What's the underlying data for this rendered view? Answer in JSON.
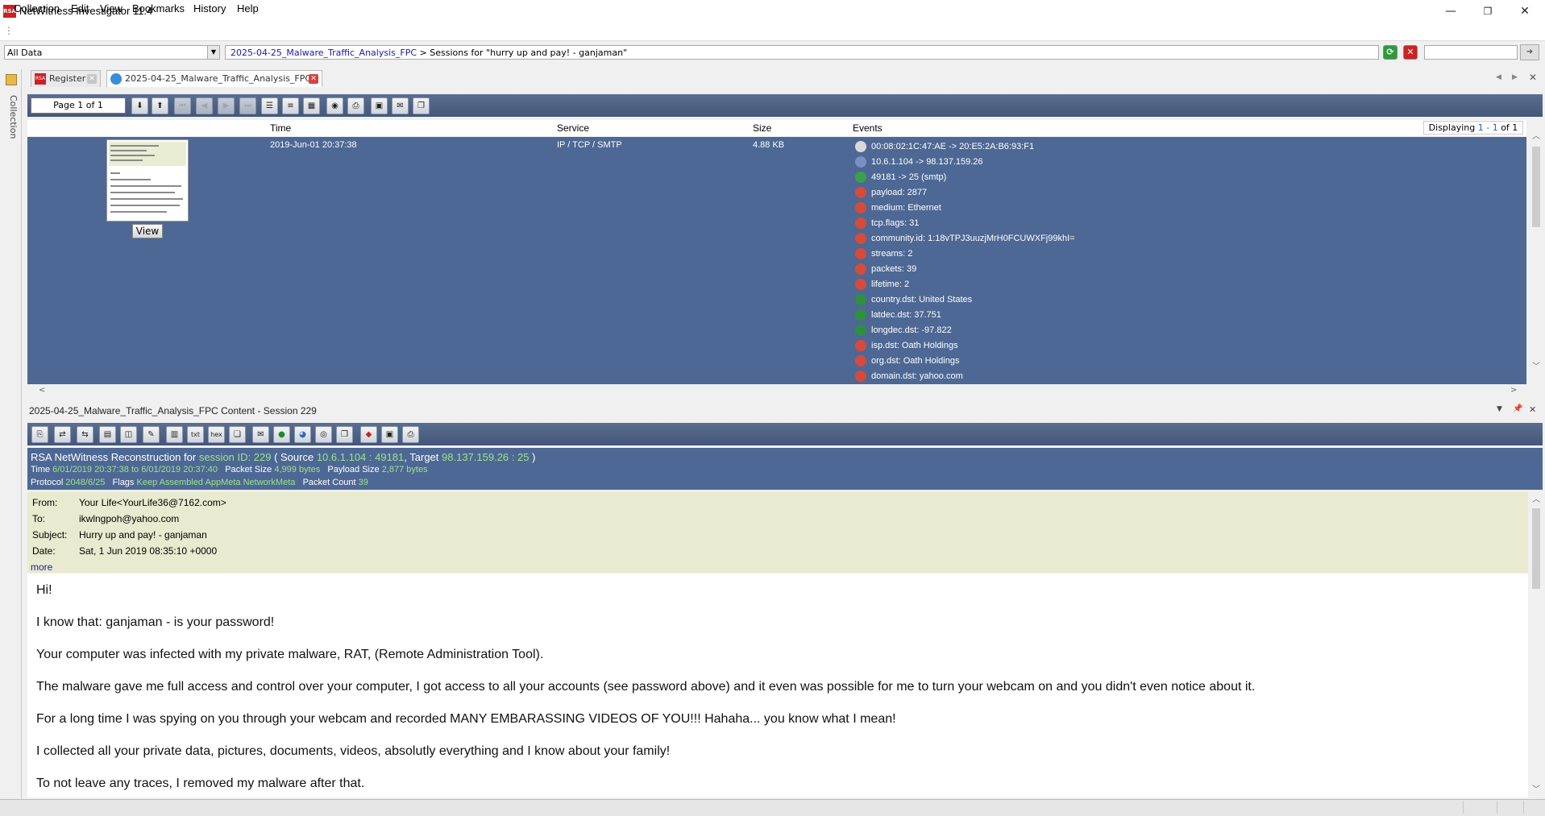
{
  "window": {
    "title": "NetWitness Investigator 11.4",
    "app_icon_text": "RSA",
    "minimize": "—",
    "maximize": "❐",
    "close": "✕"
  },
  "menu": {
    "items": [
      "Collection",
      "Edit",
      "View",
      "Bookmarks",
      "History",
      "Help"
    ]
  },
  "address": {
    "collection": "All Data",
    "breadcrumb_link": "2025-04-25_Malware_Traffic_Analysis_FPC",
    "breadcrumb_sep": ">",
    "breadcrumb_text": "Sessions for \"hurry up and pay! - ganjaman\"",
    "search_value": ""
  },
  "left_panel": {
    "label": "Collection"
  },
  "tabs": [
    {
      "label": "Register",
      "icon": "rsa-icon"
    },
    {
      "label": "2025-04-25_Malware_Traffic_Analysis_FPC",
      "icon": "collection-gear-icon"
    }
  ],
  "toolbar": {
    "page_label": "Page 1 of 1"
  },
  "session_list": {
    "headers": {
      "time": "Time",
      "service": "Service",
      "size": "Size",
      "events": "Events"
    },
    "displaying_prefix": "Displaying",
    "displaying_range": "1 - 1",
    "displaying_suffix": "of 1",
    "row": {
      "time": "2019-Jun-01 20:37:38",
      "service": "IP / TCP / SMTP",
      "size": "4.88 KB",
      "view_label": "View",
      "events": [
        {
          "text": "00:08:02:1C:47:AE -> 20:E5:2A:B6:93:F1",
          "icon": "ethernet-icon",
          "color": "#d9d9d9"
        },
        {
          "text": "10.6.1.104 -> 98.137.159.26",
          "icon": "ip-icon",
          "color": "#7a8fc4"
        },
        {
          "text": "49181 -> 25 (smtp)",
          "icon": "service-globe-icon",
          "color": "#3aa04a"
        },
        {
          "text": "payload: 2877",
          "icon": "meta-icon",
          "color": "#d84a3a"
        },
        {
          "text": "medium: Ethernet",
          "icon": "meta-icon",
          "color": "#d84a3a"
        },
        {
          "text": "tcp.flags: 31",
          "icon": "meta-icon",
          "color": "#d84a3a"
        },
        {
          "text": "community.id: 1:18vTPJ3uuzjMrH0FCUWXFj99khI=",
          "icon": "meta-icon",
          "color": "#d84a3a"
        },
        {
          "text": "streams: 2",
          "icon": "meta-icon",
          "color": "#d84a3a"
        },
        {
          "text": "packets: 39",
          "icon": "meta-icon",
          "color": "#d84a3a"
        },
        {
          "text": "lifetime: 2",
          "icon": "meta-icon",
          "color": "#d84a3a"
        },
        {
          "text": "country.dst: United States",
          "icon": "globe-icon",
          "color": "#2f8f3f"
        },
        {
          "text": "latdec.dst: 37.751",
          "icon": "globe-icon",
          "color": "#2f8f3f"
        },
        {
          "text": "longdec.dst: -97.822",
          "icon": "globe-icon",
          "color": "#2f8f3f"
        },
        {
          "text": "isp.dst: Oath Holdings",
          "icon": "meta-icon",
          "color": "#d84a3a"
        },
        {
          "text": "org.dst: Oath Holdings",
          "icon": "meta-icon",
          "color": "#d84a3a"
        },
        {
          "text": "domain.dst: yahoo.com",
          "icon": "meta-icon",
          "color": "#d84a3a"
        }
      ]
    }
  },
  "content": {
    "title": "2025-04-25_Malware_Traffic_Analysis_FPC Content - Session 229",
    "recon": {
      "prefix": "RSA NetWitness Reconstruction for",
      "session_label": "session ID: 229",
      "source_label": "( Source",
      "source": "10.6.1.104 : 49181",
      "target_label": ", Target",
      "target": "98.137.159.26 : 25",
      "close_paren": ")",
      "time_label": "Time",
      "time_value": "6/01/2019 20:37:38 to 6/01/2019 20:37:40",
      "packet_size_label": "Packet Size",
      "packet_size": "4,999 bytes",
      "payload_size_label": "Payload Size",
      "payload_size": "2,877 bytes",
      "protocol_label": "Protocol",
      "protocol": "2048/6/25",
      "flags_label": "Flags",
      "flags": "Keep Assembled AppMeta NetworkMeta",
      "packet_count_label": "Packet Count",
      "packet_count": "39"
    },
    "email": {
      "from_label": "From:",
      "from": "Your Life<YourLife36@7162.com>",
      "to_label": "To:",
      "to": "ikwlngpoh@yahoo.com",
      "subject_label": "Subject:",
      "subject": "Hurry up and pay! - ganjaman",
      "date_label": "Date:",
      "date": "Sat, 1 Jun 2019 08:35:10 +0000",
      "more": "more",
      "body": [
        "Hi!",
        "I know that: ganjaman - is your password!",
        "Your computer was infected with my private malware, RAT, (Remote Administration Tool).",
        "The malware gave me full access and control over your computer, I got access to all your accounts (see password above) and it even was possible for me to turn your webcam on and you didn't even notice about it.",
        "For a long time I was spying on you through your webcam and recorded MANY EMBARASSING VIDEOS OF YOU!!! Hahaha... you know what I mean!",
        "I collected all your private data, pictures, documents, videos, absolutly everything and I know about your family!",
        "To not leave any traces, I removed my malware after that."
      ]
    }
  }
}
